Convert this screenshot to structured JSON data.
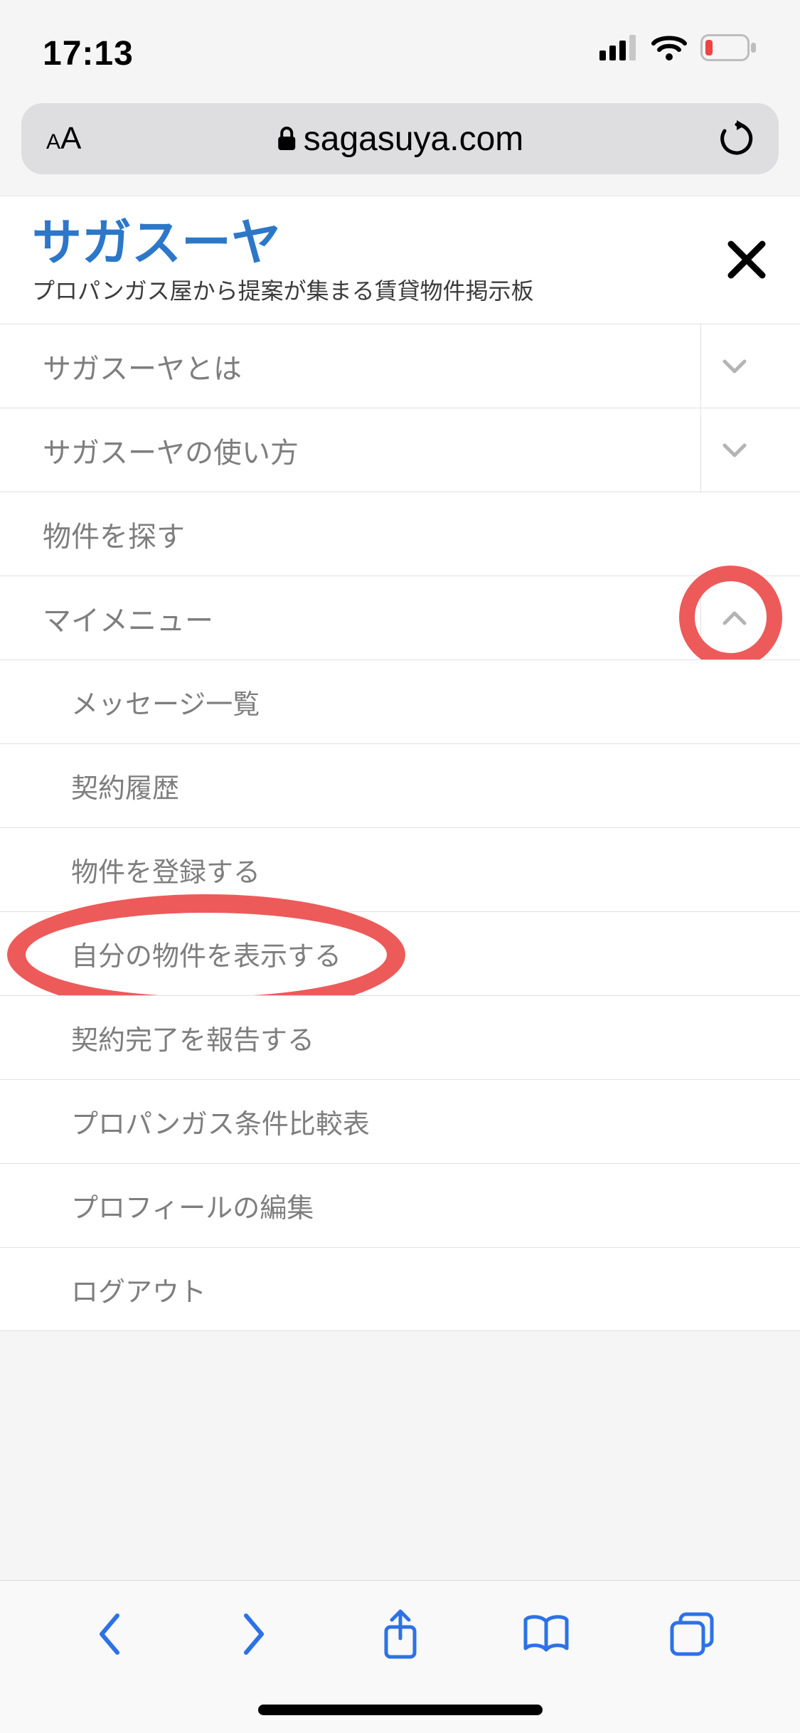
{
  "status": {
    "time": "17:13"
  },
  "address_bar": {
    "domain": "sagasuya.com"
  },
  "header": {
    "brand": "サガスーヤ",
    "subtitle": "プロパンガス屋から提案が集まる賃貸物件掲示板"
  },
  "menu": {
    "about": {
      "label": "サガスーヤとは",
      "expanded": false
    },
    "howto": {
      "label": "サガスーヤの使い方",
      "expanded": false
    },
    "search": {
      "label": "物件を探す"
    },
    "mymenu": {
      "label": "マイメニュー",
      "expanded": true,
      "items": [
        "メッセージ一覧",
        "契約履歴",
        "物件を登録する",
        "自分の物件を表示する",
        "契約完了を報告する",
        "プロパンガス条件比較表",
        "プロフィールの編集",
        "ログアウト"
      ]
    }
  },
  "colors": {
    "brand_blue": "#2d77c8",
    "annotation_red": "#ed5a5a",
    "safari_blue": "#2c72e6",
    "muted_text": "#7e7e7e"
  },
  "annotations": {
    "highlight_chevron": "mymenu-expand",
    "highlight_item_index": 3
  }
}
